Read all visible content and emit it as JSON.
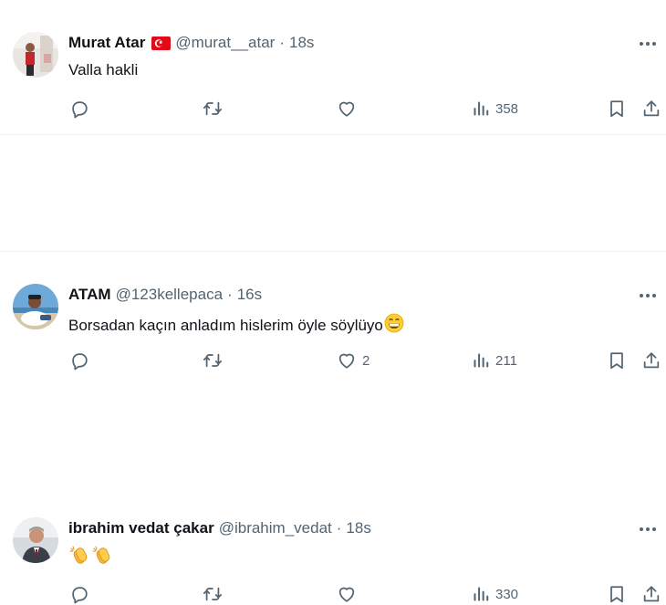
{
  "tweets": [
    {
      "name": "Murat Atar",
      "handle": "@murat__atar",
      "separator": "·",
      "time": "18s",
      "has_flag": true,
      "text": "Valla hakli",
      "likes": "",
      "views": "358"
    },
    {
      "name": "ATAM",
      "handle": "@123kellepaca",
      "separator": "·",
      "time": "16s",
      "has_flag": false,
      "text": "Borsadan kaçın anladım hislerim öyle söylüyo",
      "likes": "2",
      "views": "211"
    },
    {
      "name": "ibrahim vedat çakar",
      "handle": "@ibrahim_vedat",
      "separator": "·",
      "time": "18s",
      "has_flag": false,
      "text": "",
      "likes": "",
      "views": "330"
    }
  ],
  "icons": {
    "more": "more-dots-icon",
    "reply": "reply-icon",
    "retweet": "retweet-icon",
    "like": "heart-icon",
    "views": "views-bar-chart-icon",
    "bookmark": "bookmark-icon",
    "share": "share-icon",
    "flag": "turkey-flag-icon",
    "emoji_grin": "grinning-face-icon",
    "emoji_clap": "clapping-hands-icon"
  },
  "colors": {
    "text": "#0f1419",
    "secondary": "#536471",
    "divider": "#eff3f4",
    "flag_red": "#e30a17"
  }
}
